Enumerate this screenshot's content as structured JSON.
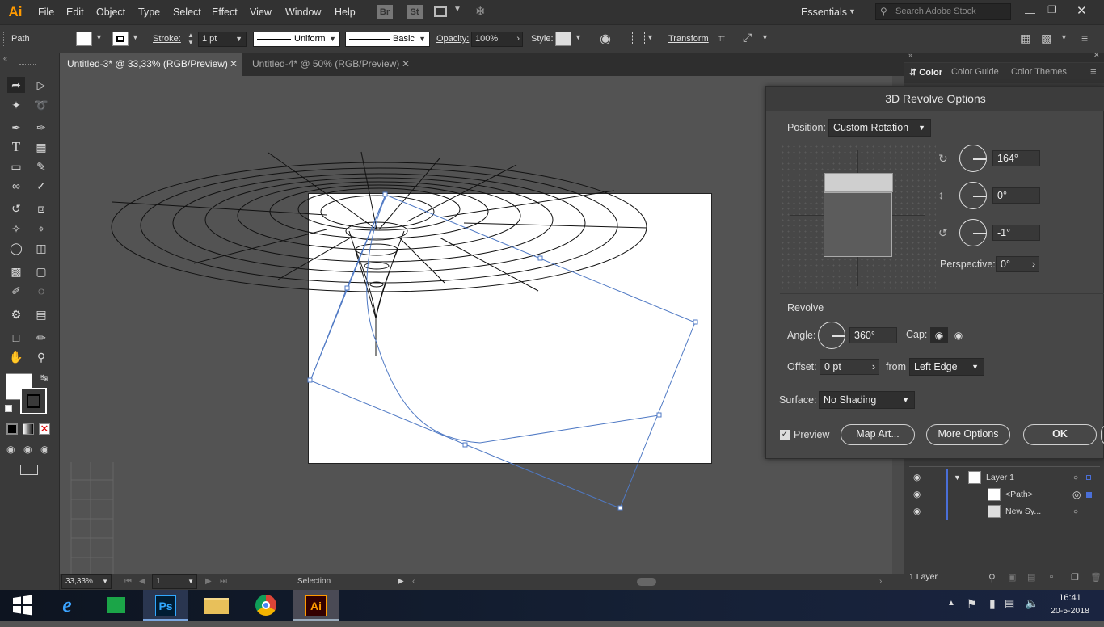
{
  "app": {
    "logo": "Ai",
    "workspace": "Essentials",
    "search_placeholder": "Search Adobe Stock"
  },
  "menu": [
    "File",
    "Edit",
    "Object",
    "Type",
    "Select",
    "Effect",
    "View",
    "Window",
    "Help"
  ],
  "bridge_labels": {
    "br": "Br",
    "st": "St"
  },
  "control": {
    "object_type": "Path",
    "stroke_label": "Stroke:",
    "stroke_value": "1 pt",
    "profile": "Uniform",
    "brush": "Basic",
    "opacity_label": "Opacity:",
    "opacity_value": "100%",
    "style_label": "Style:",
    "transform": "Transform"
  },
  "tabs": [
    {
      "label": "Untitled-3* @ 33,33% (RGB/Preview)",
      "active": true
    },
    {
      "label": "Untitled-4* @ 50% (RGB/Preview)",
      "active": false
    }
  ],
  "status": {
    "zoom": "33,33%",
    "artboard": "1",
    "tool": "Selection"
  },
  "color_panel": {
    "tabs": [
      "Color",
      "Color Guide",
      "Color Themes"
    ]
  },
  "dialog": {
    "title": "3D Revolve Options",
    "position_label": "Position:",
    "position_value": "Custom Rotation",
    "rot_x": "164°",
    "rot_y": "0°",
    "rot_z": "-1°",
    "perspective_label": "Perspective:",
    "perspective_value": "0°",
    "revolve_section": "Revolve",
    "angle_label": "Angle:",
    "angle_value": "360°",
    "cap_label": "Cap:",
    "offset_label": "Offset:",
    "offset_value": "0 pt",
    "from_label": "from",
    "from_value": "Left Edge",
    "surface_label": "Surface:",
    "surface_value": "No Shading",
    "preview_label": "Preview",
    "map_art": "Map Art...",
    "more_options": "More Options",
    "ok": "OK"
  },
  "layers": {
    "rows": [
      {
        "name": "Layer 1"
      },
      {
        "name": "<Path>"
      },
      {
        "name": "New Sy..."
      }
    ],
    "count": "1 Layer"
  },
  "taskbar": {
    "time": "16:41",
    "date": "20-5-2018",
    "ps": "Ps",
    "ai": "Ai"
  }
}
